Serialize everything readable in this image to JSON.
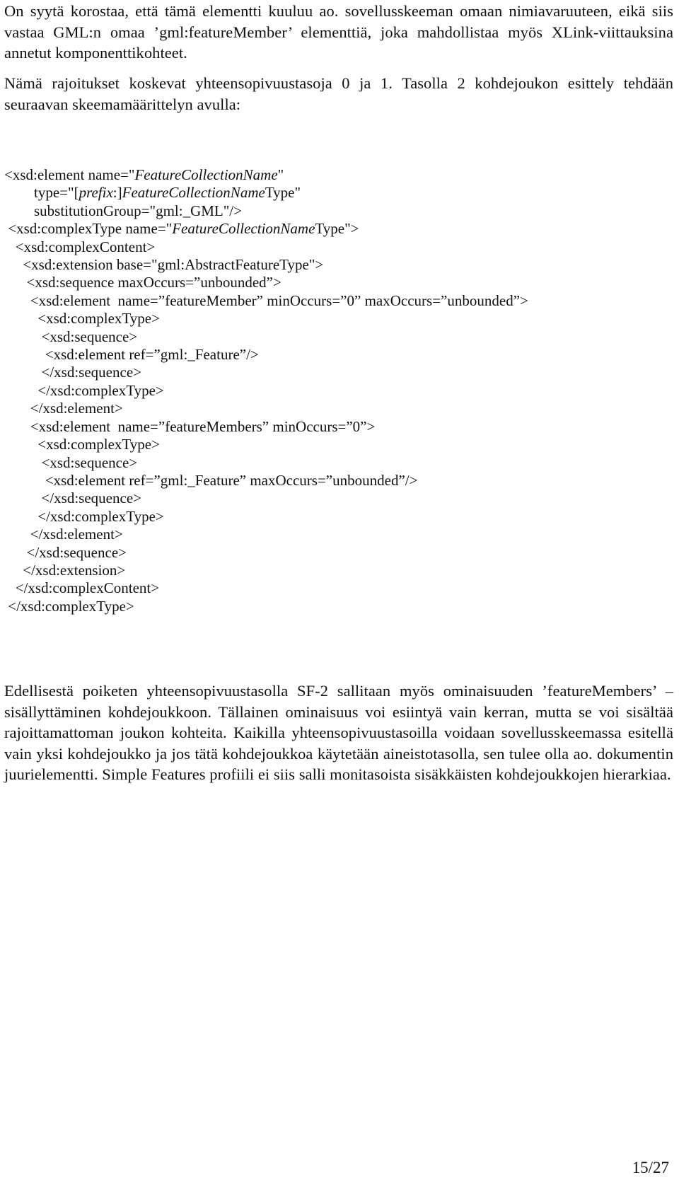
{
  "document": {
    "page_label": "15/27",
    "paragraphs": {
      "intro": "On syytä korostaa, että tämä elementti kuuluu ao. sovellusskeeman omaan nimiavaruuteen, eikä siis vastaa GML:n omaa ’gml:featureMember’ elementtiä, joka mahdollistaa myös XLink-viittauksina annetut komponenttikohteet.",
      "schema_intro": "Nämä rajoitukset koskevat yhteensopivuustasoja 0 ja 1. Tasolla 2 kohdejoukon esittely tehdään seuraavan skeemamäärittelyn avulla:",
      "closing": "Edellisestä poiketen yhteensopivuustasolla SF-2 sallitaan myös ominaisuuden ’featureMembers’ –sisällyttäminen kohdejoukkoon. Tällainen ominaisuus voi esiintyä vain kerran, mutta se voi sisältää rajoittamattoman joukon kohteita. Kaikilla yhteensopivuustasoilla voidaan sovellusskeemassa esitellä vain yksi kohdejoukko ja jos tätä kohdejoukkoa käytetään aineistotasolla, sen tulee olla ao. dokumentin juurielementti. Simple Features profiili ei siis salli monitasoista sisäkkäisten kohdejoukkojen hierarkiaa."
    },
    "code_listing": {
      "language": "xsd",
      "lines": [
        "<xsd:element name=\"{i}FeatureCollectionName{/i}\"",
        "        type=\"[{i}prefix{/i}:]{i}FeatureCollectionName{/i}Type\"",
        "        substitutionGroup=\"gml:_GML\"/>",
        " <xsd:complexType name=\"{i}FeatureCollectionName{/i}Type\">",
        "   <xsd:complexContent>",
        "     <xsd:extension base=\"gml:AbstractFeatureType\">",
        "      <xsd:sequence maxOccurs=”unbounded”>",
        "       <xsd:element  name=”featureMember” minOccurs=”0” maxOccurs=”unbounded”>",
        "         <xsd:complexType>",
        "          <xsd:sequence>",
        "           <xsd:element ref=”gml:_Feature”/>",
        "          </xsd:sequence>",
        "         </xsd:complexType>",
        "       </xsd:element>",
        "       <xsd:element  name=”featureMembers” minOccurs=”0”>",
        "         <xsd:complexType>",
        "          <xsd:sequence>",
        "           <xsd:element ref=”gml:_Feature” maxOccurs=”unbounded”/>",
        "          </xsd:sequence>",
        "         </xsd:complexType>",
        "       </xsd:element>",
        "      </xsd:sequence>",
        "     </xsd:extension>",
        "   </xsd:complexContent>",
        " </xsd:complexType>"
      ]
    }
  }
}
